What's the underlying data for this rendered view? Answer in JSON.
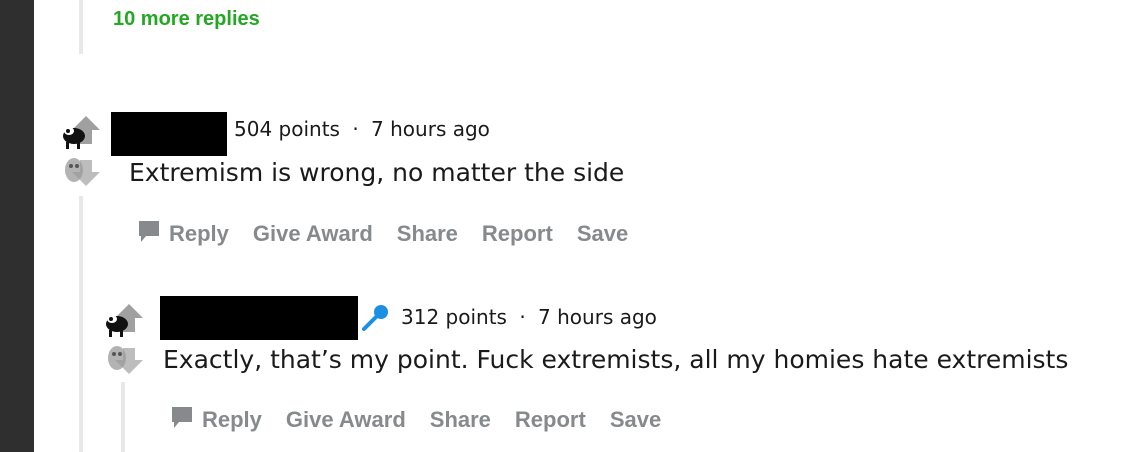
{
  "thread": {
    "more_replies_label": "10 more replies"
  },
  "comments": [
    {
      "points": "504 points",
      "separator": "·",
      "time": "7 hours ago",
      "body": "Extremism is wrong, no matter the side",
      "actions": {
        "reply": "Reply",
        "give_award": "Give Award",
        "share": "Share",
        "report": "Report",
        "save": "Save"
      }
    },
    {
      "points": "312 points",
      "separator": "·",
      "time": "7 hours ago",
      "body": "Exactly, that’s my point. Fuck extremists, all my homies hate extremists",
      "actions": {
        "reply": "Reply",
        "give_award": "Give Award",
        "share": "Share",
        "report": "Report",
        "save": "Save"
      }
    }
  ],
  "colors": {
    "more_replies": "#23a823",
    "action_text": "#878a8c",
    "mic_icon": "#1a8fe3",
    "left_rail": "#2f2f2f"
  }
}
